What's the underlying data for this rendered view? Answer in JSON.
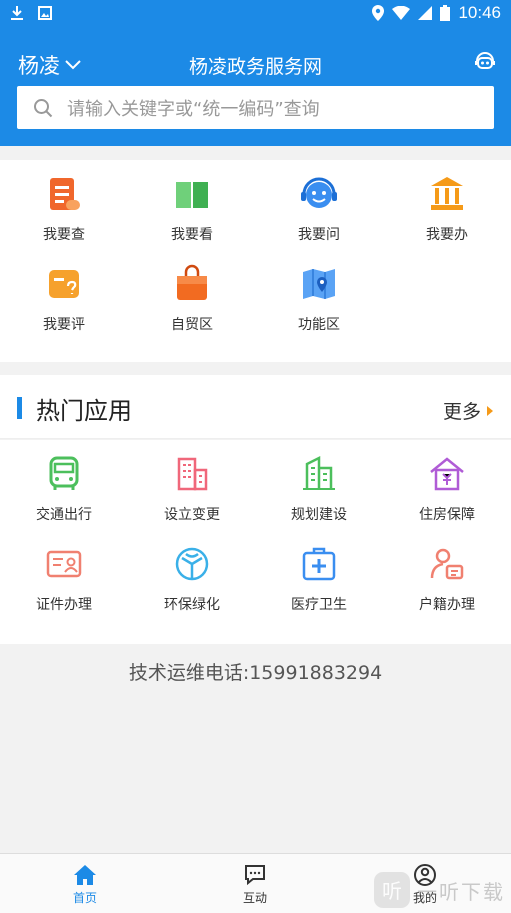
{
  "status_bar": {
    "time": "10:46"
  },
  "header": {
    "city": "杨凌",
    "title": "杨凌政务服务网"
  },
  "search": {
    "placeholder": "请输入关键字或“统一编码”查询"
  },
  "quick_grid": [
    {
      "label": "我要查",
      "icon": "document-query-icon",
      "color": "#f0672c"
    },
    {
      "label": "我要看",
      "icon": "open-book-icon",
      "color": "#4cbf5c"
    },
    {
      "label": "我要问",
      "icon": "customer-service-icon",
      "color": "#3a8ef0"
    },
    {
      "label": "我要办",
      "icon": "government-building-icon",
      "color": "#f59a18"
    },
    {
      "label": "我要评",
      "icon": "evaluate-card-icon",
      "color": "#f6a12c"
    },
    {
      "label": "自贸区",
      "icon": "shopping-bag-icon",
      "color": "#f26b21"
    },
    {
      "label": "功能区",
      "icon": "map-pin-icon",
      "color": "#3a8ef0"
    }
  ],
  "hot_apps": {
    "title": "热门应用",
    "more": "更多",
    "items": [
      {
        "label": "交通出行",
        "icon": "bus-icon",
        "color": "#4cbf5c"
      },
      {
        "label": "设立变更",
        "icon": "buildings-icon",
        "color": "#f0677a"
      },
      {
        "label": "规划建设",
        "icon": "construction-icon",
        "color": "#4cbf5c"
      },
      {
        "label": "住房保障",
        "icon": "house-icon",
        "color": "#b05cd6"
      },
      {
        "label": "证件办理",
        "icon": "id-card-icon",
        "color": "#f08070"
      },
      {
        "label": "环保绿化",
        "icon": "recycle-icon",
        "color": "#3ab0e8"
      },
      {
        "label": "医疗卫生",
        "icon": "medical-kit-icon",
        "color": "#3a8ef0"
      },
      {
        "label": "户籍办理",
        "icon": "person-card-icon",
        "color": "#f08070"
      }
    ]
  },
  "hotline": "技术运维电话:15991883294",
  "tabs": [
    {
      "label": "首页",
      "icon": "home-icon",
      "active": true
    },
    {
      "label": "互动",
      "icon": "chat-icon",
      "active": false
    },
    {
      "label": "我的",
      "icon": "user-icon",
      "active": false
    }
  ],
  "watermark": {
    "text": "一听下载"
  },
  "colors": {
    "primary": "#1c8ae6"
  }
}
